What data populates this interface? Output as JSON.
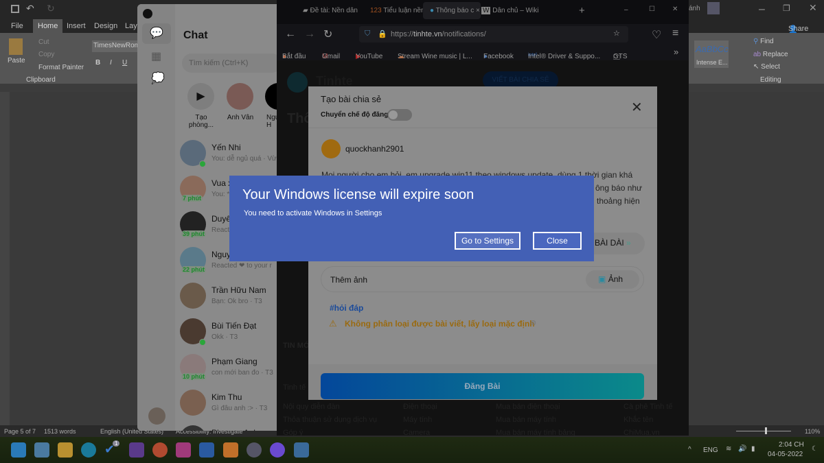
{
  "word": {
    "tabs": [
      "File",
      "Home",
      "Insert",
      "Design",
      "Layo"
    ],
    "font_name": "TimesNewRom",
    "clipboard": {
      "paste": "Paste",
      "cut": "Cut",
      "copy": "Copy",
      "format_painter": "Format Painter",
      "group": "Clipboard"
    },
    "format_buttons": [
      "B",
      "I",
      "U"
    ],
    "style_preview": "AaBbCc",
    "style_name": "Intense E...",
    "editing": {
      "find": "Find",
      "replace": "Replace",
      "select": "Select",
      "group": "Editing"
    },
    "user": "ánh",
    "share": "Share",
    "status": {
      "page": "Page 5 of 7",
      "words": "1513 words",
      "language": "English (United States)",
      "accessibility": "Accessibility: Investigate",
      "zoom": "110%",
      "zoom_percent": 110
    }
  },
  "messenger": {
    "title": "Chat",
    "search_placeholder": "Tìm kiếm (Ctrl+K)",
    "stories": [
      {
        "label": "Tạo phòng..."
      },
      {
        "label": "Anh Vân"
      },
      {
        "label": "Ngu H"
      }
    ],
    "chats": [
      {
        "name": "Yến Nhi",
        "preview": "You: dễ ngủ quá · Vừ",
        "online": true,
        "badge": ""
      },
      {
        "name": "Vua x",
        "preview": "You: *",
        "online": false,
        "badge": "7 phút"
      },
      {
        "name": "Duyê",
        "preview": "Reacte",
        "online": false,
        "badge": "39 phút"
      },
      {
        "name": "Nguy",
        "preview": "Reacted ❤ to your r",
        "online": false,
        "badge": "22 phút"
      },
      {
        "name": "Trần Hữu Nam",
        "preview": "Bạn: Ok bro · T3",
        "online": false,
        "badge": ""
      },
      {
        "name": "Bùi Tiến Đạt",
        "preview": "Okk · T3",
        "online": true,
        "badge": ""
      },
      {
        "name": "Phạm Giang",
        "preview": "con mới ban đo · T3",
        "online": false,
        "badge": "10 phút"
      },
      {
        "name": "Kim Thu",
        "preview": "Gì đâu anh :> · T3",
        "online": false,
        "badge": ""
      },
      {
        "name": "Phương Anh",
        "preview": "",
        "online": false,
        "badge": ""
      }
    ]
  },
  "firefox": {
    "tabs": [
      "Đề tài: Nền dân",
      "Tiểu luận nền d",
      "Thông báo c",
      "Dân chủ – Wiki"
    ],
    "active_tab": 2,
    "url_prefix": "https://",
    "url_host": "tinhte.vn",
    "url_path": "/notifications/",
    "bookmarks": [
      "Bắt đầu",
      "Gmail",
      "YouTube",
      "Stream Wine music | L...",
      "Facebook",
      "Intel® Driver & Suppo...",
      "GTS"
    ],
    "page": {
      "logo": "Tinhte",
      "write_button": "VIẾT BÀI CHIA SẺ",
      "heading": "Thô",
      "section": "TIN MỚ",
      "footer_title": "Tinh tế",
      "footer_cols": [
        [
          "Nội quy diễn đàn",
          "Thỏa thuận sử dụng dịch vụ",
          "Góp ý"
        ],
        [
          "Điện thoại",
          "Máy tính",
          "Camera"
        ],
        [
          "Mua bán điện thoại",
          "Mua bán máy tính",
          "Mua bán máy tính bảng"
        ],
        [
          "Cà phê Tinh tế",
          "Khắc tên",
          "ChiMua.vn"
        ]
      ]
    }
  },
  "modal": {
    "title": "Tạo bài chia sẻ",
    "mode_label": "Chuyển chế độ đăng:",
    "username": "quockhanh2901",
    "body_lines": [
      "Mọi người cho em hỏi, em upgrade win11 theo windows update, dùng 1 thời gian khá",
      "ông báo như",
      "thoảng hiện"
    ],
    "long_post": "BÀI DÀI",
    "add_image": "Thêm ảnh",
    "image_button": "Ảnh",
    "tag": "#hỏi đáp",
    "warning": "Không phân loại được bài viết, lấy loại mặc định",
    "submit": "Đăng Bài"
  },
  "license": {
    "title": "Your Windows license will expire soon",
    "message": "You need to activate Windows in Settings",
    "settings_button": "Go to Settings",
    "close_button": "Close",
    "color": "#4360b5"
  },
  "tray": {
    "lang": "ENG",
    "time": "2:04 CH",
    "date": "04-05-2022",
    "update_badge": "1"
  }
}
